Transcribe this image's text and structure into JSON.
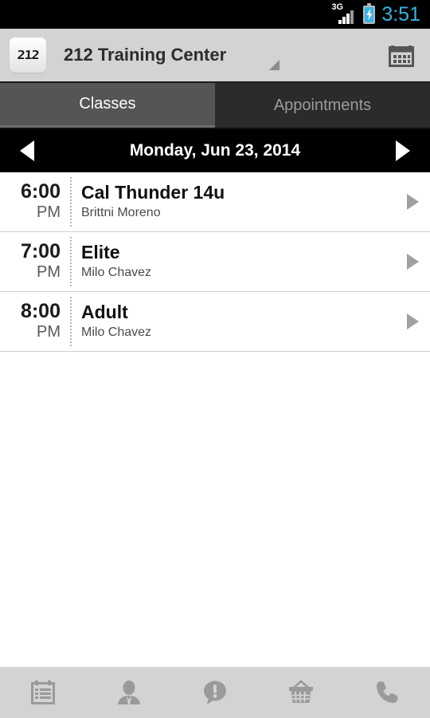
{
  "statusbar": {
    "network_label": "3G",
    "signal_icon": "signal-bars-icon",
    "battery_icon": "battery-charging-icon",
    "time": "3:51",
    "accent_color": "#33b5e5"
  },
  "header": {
    "logo_text": "212",
    "logo_icon": "app-logo-212",
    "title": "212 Training Center",
    "spinner_icon": "dropdown-caret-icon",
    "calendar_icon": "calendar-icon",
    "background_color": "#d3d3d3"
  },
  "tabs": [
    {
      "label": "Classes",
      "active": true
    },
    {
      "label": "Appointments",
      "active": false
    }
  ],
  "datebar": {
    "prev_icon": "previous-day-arrow-icon",
    "next_icon": "next-day-arrow-icon",
    "date": "Monday, Jun 23, 2014",
    "background_color": "#000000"
  },
  "classes": [
    {
      "time": "6:00",
      "meridiem": "PM",
      "name": "Cal Thunder 14u",
      "instructor": "Brittni Moreno",
      "caret_icon": "row-chevron-icon"
    },
    {
      "time": "7:00",
      "meridiem": "PM",
      "name": "Elite",
      "instructor": "Milo Chavez",
      "caret_icon": "row-chevron-icon"
    },
    {
      "time": "8:00",
      "meridiem": "PM",
      "name": "Adult",
      "instructor": "Milo Chavez",
      "caret_icon": "row-chevron-icon"
    }
  ],
  "toolbar": {
    "items": [
      {
        "icon": "schedule-icon",
        "label": "Schedule"
      },
      {
        "icon": "profile-icon",
        "label": "Profile"
      },
      {
        "icon": "alerts-icon",
        "label": "Alerts"
      },
      {
        "icon": "store-basket-icon",
        "label": "Store"
      },
      {
        "icon": "phone-icon",
        "label": "Call"
      }
    ],
    "background_color": "#d3d3d3",
    "icon_color": "#9a9a9a"
  }
}
